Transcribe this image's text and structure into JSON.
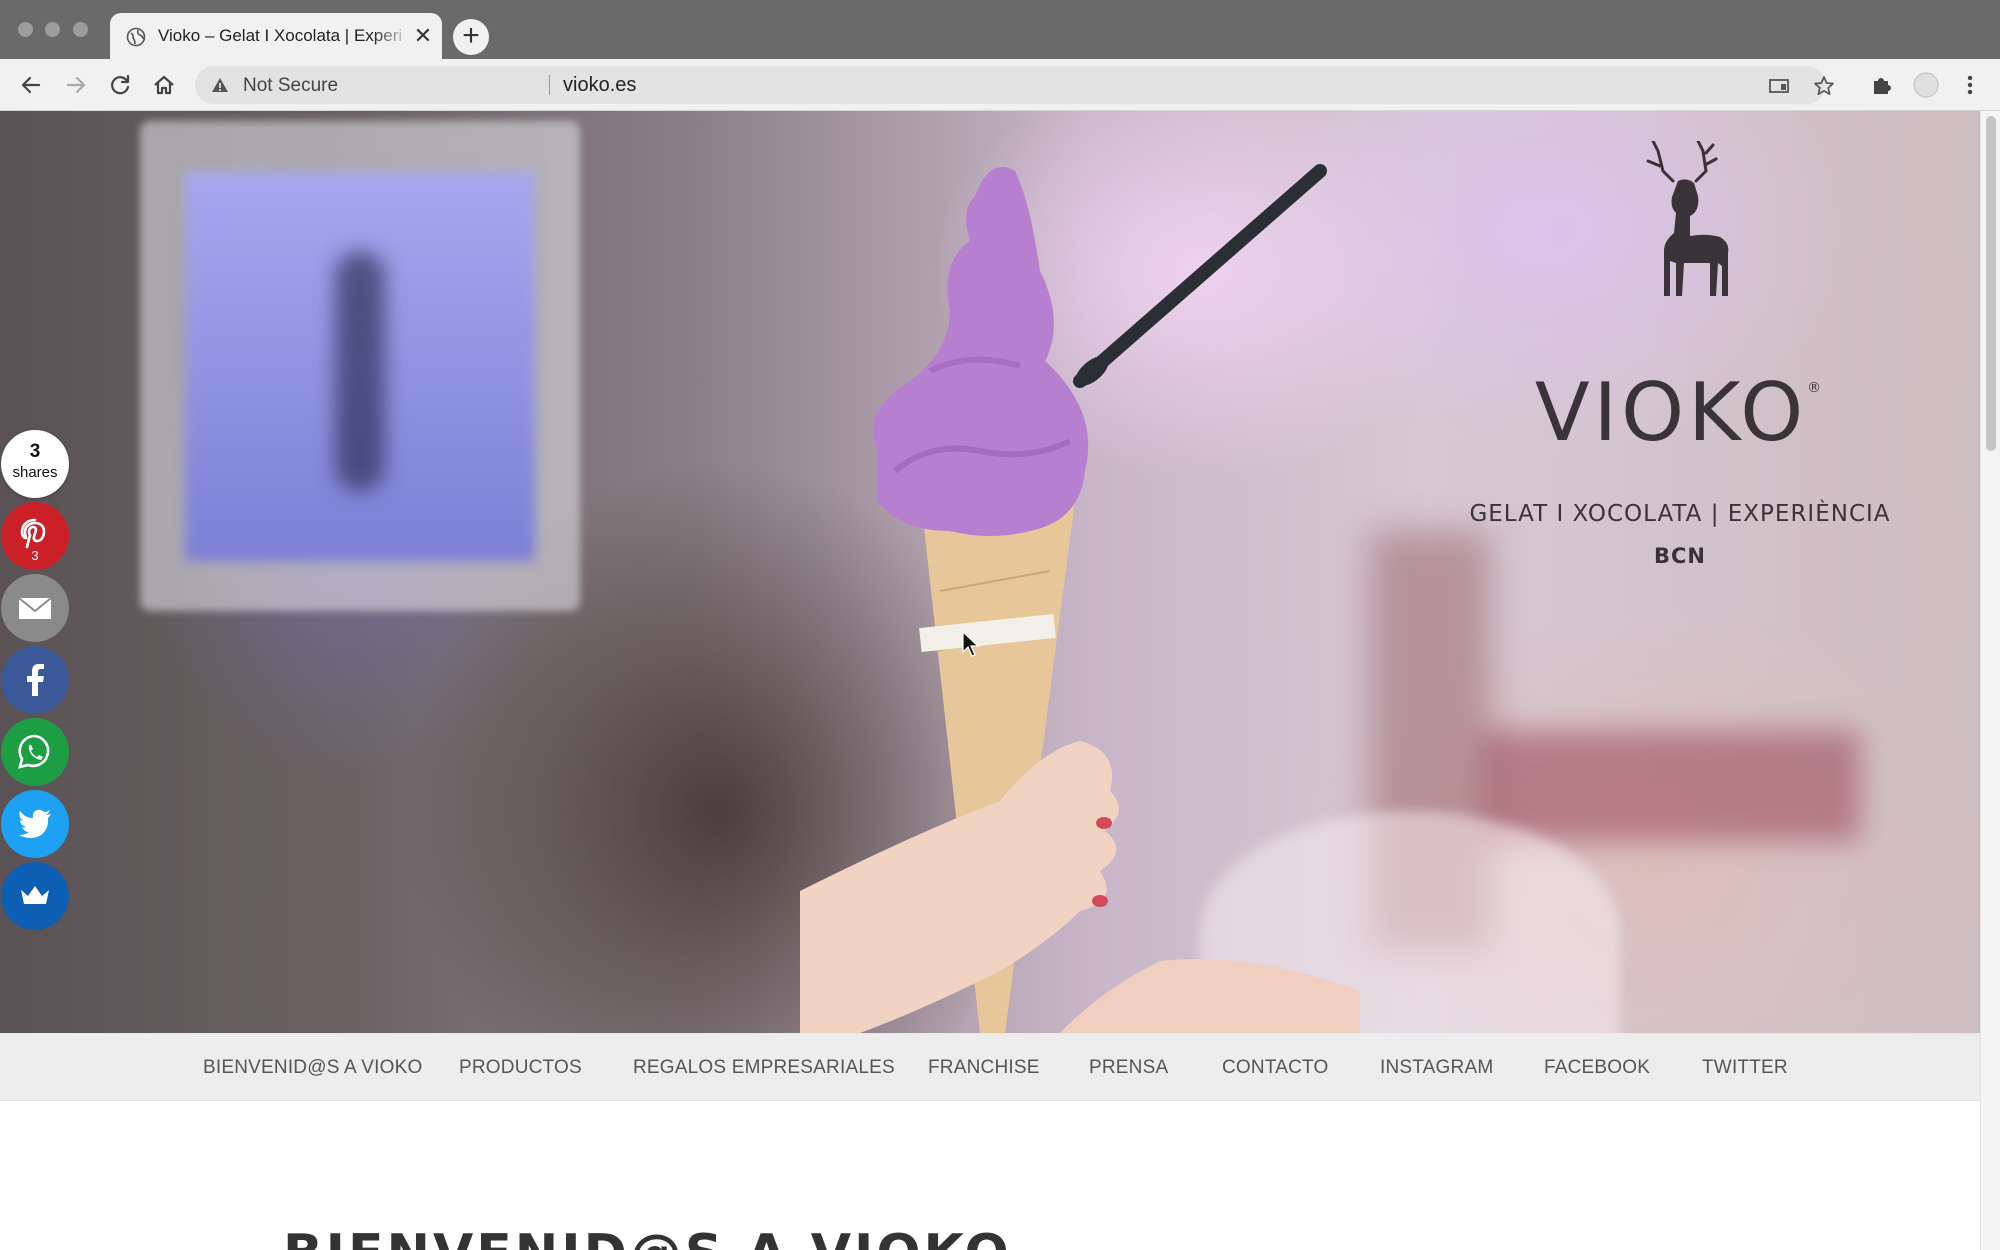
{
  "browser": {
    "tab": {
      "title": "Vioko – Gelat I Xocolata | Experiència",
      "close_glyph": "✕"
    },
    "new_tab_glyph": "+",
    "address": {
      "security_label": "Not Secure",
      "url": "vioko.es"
    },
    "icons": [
      "back-icon",
      "forward-icon",
      "reload-icon",
      "home-icon",
      "warning-icon",
      "cast-icon",
      "star-icon",
      "extensions-icon",
      "profile-icon",
      "menu-icon"
    ]
  },
  "hero": {
    "brand": {
      "name": "VIOKO",
      "registered": "®",
      "tagline": "GELAT I XOCOLATA | EXPERIÈNCIA",
      "city": "BCN"
    }
  },
  "share": {
    "total": "3",
    "total_label": "shares",
    "pinterest_count": "3",
    "buttons": [
      {
        "name": "pinterest",
        "color": "#cb2027"
      },
      {
        "name": "email",
        "color": "#888888"
      },
      {
        "name": "facebook",
        "color": "#3b5998"
      },
      {
        "name": "whatsapp",
        "color": "#1d9e44"
      },
      {
        "name": "twitter",
        "color": "#1da1f2"
      },
      {
        "name": "sumo",
        "color": "#0d5fb4"
      }
    ]
  },
  "nav": {
    "items": [
      "BIENVENID@S A VIOKO",
      "PRODUCTOS",
      "REGALOS EMPRESARIALES",
      "FRANCHISE",
      "PRENSA",
      "CONTACTO",
      "INSTAGRAM",
      "FACEBOOK",
      "TWITTER"
    ]
  },
  "content": {
    "heading": "BIENVENID@S A VIOKO"
  }
}
